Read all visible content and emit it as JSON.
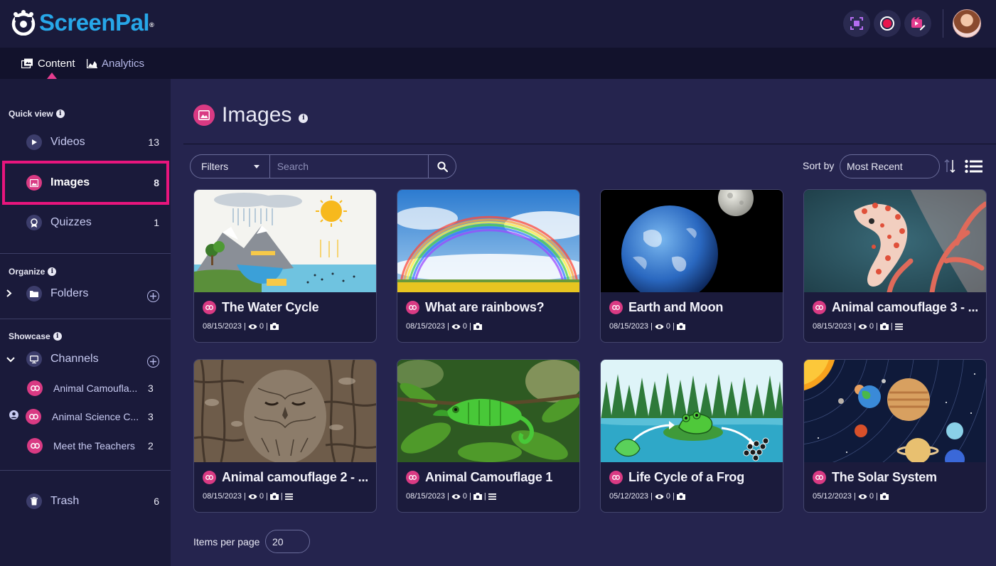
{
  "brand": {
    "name": "ScreenPal",
    "trademark": "®"
  },
  "nav": {
    "tabs": [
      {
        "label": "Content",
        "active": true,
        "icon": "content-icon"
      },
      {
        "label": "Analytics",
        "active": false,
        "icon": "analytics-chart-icon"
      }
    ]
  },
  "toolbar": {
    "icons": [
      "screenshot-capture-icon",
      "record-icon",
      "video-editor-icon"
    ],
    "accent": "#e53d8f"
  },
  "sidebar": {
    "quick_view": {
      "heading": "Quick view",
      "items": [
        {
          "label": "Videos",
          "count": "13",
          "icon": "play-icon"
        },
        {
          "label": "Images",
          "count": "8",
          "icon": "image-icon",
          "selected": true
        },
        {
          "label": "Quizzes",
          "count": "1",
          "icon": "quiz-ribbon-icon"
        }
      ]
    },
    "organize": {
      "heading": "Organize",
      "folders_label": "Folders"
    },
    "showcase": {
      "heading": "Showcase",
      "channels_label": "Channels",
      "channels": [
        {
          "label": "Animal Camoufla...",
          "count": "3"
        },
        {
          "label": "Animal Science C...",
          "count": "3"
        },
        {
          "label": "Meet the Teachers",
          "count": "2"
        }
      ]
    },
    "trash": {
      "label": "Trash",
      "count": "6"
    }
  },
  "main": {
    "title": "Images",
    "filters_label": "Filters",
    "search_placeholder": "Search",
    "sort_label": "Sort by",
    "sort_value": "Most Recent",
    "items_per_page_label": "Items per page",
    "items_per_page_value": "20"
  },
  "cards": [
    {
      "title": "The Water Cycle",
      "date": "08/15/2023",
      "views": "0",
      "has_list": false
    },
    {
      "title": "What are rainbows?",
      "date": "08/15/2023",
      "views": "0",
      "has_list": false
    },
    {
      "title": "Earth and Moon",
      "date": "08/15/2023",
      "views": "0",
      "has_list": false
    },
    {
      "title": "Animal camouflage 3 - ...",
      "date": "08/15/2023",
      "views": "0",
      "has_list": true
    },
    {
      "title": "Animal camouflage 2 - ...",
      "date": "08/15/2023",
      "views": "0",
      "has_list": true
    },
    {
      "title": "Animal Camouflage 1",
      "date": "08/15/2023",
      "views": "0",
      "has_list": true
    },
    {
      "title": "Life Cycle of a Frog",
      "date": "05/12/2023",
      "views": "0",
      "has_list": false
    },
    {
      "title": "The Solar System",
      "date": "05/12/2023",
      "views": "0",
      "has_list": false
    }
  ],
  "colors": {
    "sidebar_bg": "#1a1a3a",
    "main_bg": "#25244e",
    "pink": "#d93a83",
    "highlight": "#e8157d",
    "logo_blue": "#27a7e8"
  }
}
